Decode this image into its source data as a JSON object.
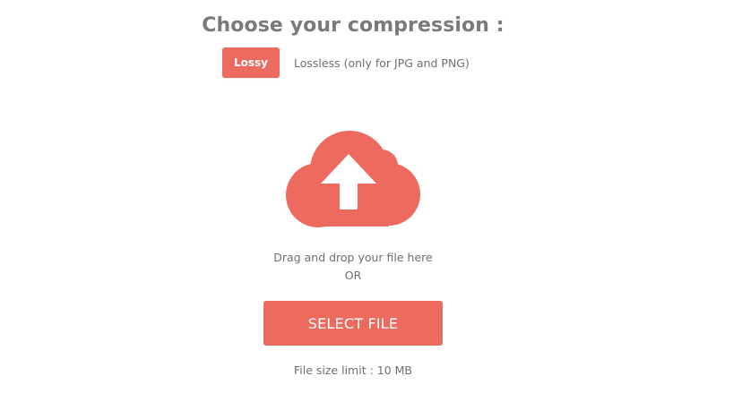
{
  "header": {
    "title": "Choose your compression :"
  },
  "compression": {
    "lossy_label": "Lossy",
    "lossless_label": "Lossless (only for JPG and PNG)",
    "selected": "Lossy"
  },
  "upload": {
    "icon": "cloud-upload-icon",
    "drag_text": "Drag and drop your file here",
    "or_text": "OR",
    "button_label": "SELECT FILE",
    "size_limit": "File size limit : 10 MB"
  },
  "colors": {
    "accent": "#ec6b5e",
    "text": "#6f6f6f",
    "title": "#7a7a7a"
  }
}
